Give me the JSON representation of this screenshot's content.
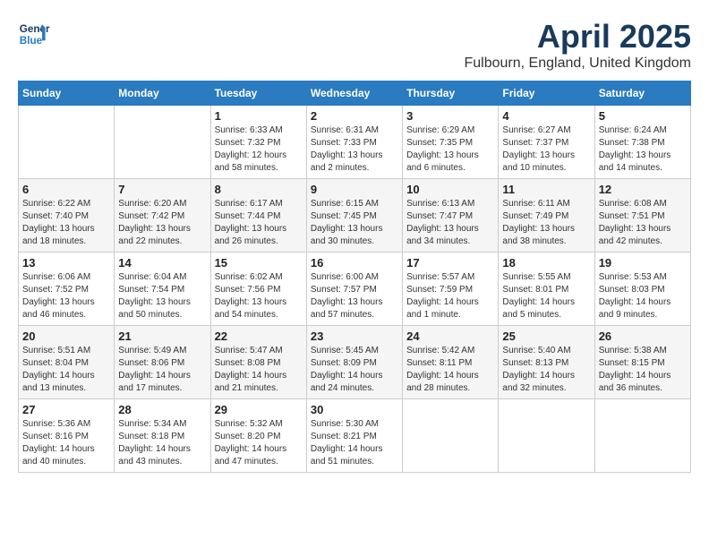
{
  "logo": {
    "line1": "General",
    "line2": "Blue"
  },
  "title": "April 2025",
  "location": "Fulbourn, England, United Kingdom",
  "days_of_week": [
    "Sunday",
    "Monday",
    "Tuesday",
    "Wednesday",
    "Thursday",
    "Friday",
    "Saturday"
  ],
  "weeks": [
    [
      {
        "day": "",
        "sunrise": "",
        "sunset": "",
        "daylight": ""
      },
      {
        "day": "",
        "sunrise": "",
        "sunset": "",
        "daylight": ""
      },
      {
        "day": "1",
        "sunrise": "Sunrise: 6:33 AM",
        "sunset": "Sunset: 7:32 PM",
        "daylight": "Daylight: 12 hours and 58 minutes."
      },
      {
        "day": "2",
        "sunrise": "Sunrise: 6:31 AM",
        "sunset": "Sunset: 7:33 PM",
        "daylight": "Daylight: 13 hours and 2 minutes."
      },
      {
        "day": "3",
        "sunrise": "Sunrise: 6:29 AM",
        "sunset": "Sunset: 7:35 PM",
        "daylight": "Daylight: 13 hours and 6 minutes."
      },
      {
        "day": "4",
        "sunrise": "Sunrise: 6:27 AM",
        "sunset": "Sunset: 7:37 PM",
        "daylight": "Daylight: 13 hours and 10 minutes."
      },
      {
        "day": "5",
        "sunrise": "Sunrise: 6:24 AM",
        "sunset": "Sunset: 7:38 PM",
        "daylight": "Daylight: 13 hours and 14 minutes."
      }
    ],
    [
      {
        "day": "6",
        "sunrise": "Sunrise: 6:22 AM",
        "sunset": "Sunset: 7:40 PM",
        "daylight": "Daylight: 13 hours and 18 minutes."
      },
      {
        "day": "7",
        "sunrise": "Sunrise: 6:20 AM",
        "sunset": "Sunset: 7:42 PM",
        "daylight": "Daylight: 13 hours and 22 minutes."
      },
      {
        "day": "8",
        "sunrise": "Sunrise: 6:17 AM",
        "sunset": "Sunset: 7:44 PM",
        "daylight": "Daylight: 13 hours and 26 minutes."
      },
      {
        "day": "9",
        "sunrise": "Sunrise: 6:15 AM",
        "sunset": "Sunset: 7:45 PM",
        "daylight": "Daylight: 13 hours and 30 minutes."
      },
      {
        "day": "10",
        "sunrise": "Sunrise: 6:13 AM",
        "sunset": "Sunset: 7:47 PM",
        "daylight": "Daylight: 13 hours and 34 minutes."
      },
      {
        "day": "11",
        "sunrise": "Sunrise: 6:11 AM",
        "sunset": "Sunset: 7:49 PM",
        "daylight": "Daylight: 13 hours and 38 minutes."
      },
      {
        "day": "12",
        "sunrise": "Sunrise: 6:08 AM",
        "sunset": "Sunset: 7:51 PM",
        "daylight": "Daylight: 13 hours and 42 minutes."
      }
    ],
    [
      {
        "day": "13",
        "sunrise": "Sunrise: 6:06 AM",
        "sunset": "Sunset: 7:52 PM",
        "daylight": "Daylight: 13 hours and 46 minutes."
      },
      {
        "day": "14",
        "sunrise": "Sunrise: 6:04 AM",
        "sunset": "Sunset: 7:54 PM",
        "daylight": "Daylight: 13 hours and 50 minutes."
      },
      {
        "day": "15",
        "sunrise": "Sunrise: 6:02 AM",
        "sunset": "Sunset: 7:56 PM",
        "daylight": "Daylight: 13 hours and 54 minutes."
      },
      {
        "day": "16",
        "sunrise": "Sunrise: 6:00 AM",
        "sunset": "Sunset: 7:57 PM",
        "daylight": "Daylight: 13 hours and 57 minutes."
      },
      {
        "day": "17",
        "sunrise": "Sunrise: 5:57 AM",
        "sunset": "Sunset: 7:59 PM",
        "daylight": "Daylight: 14 hours and 1 minute."
      },
      {
        "day": "18",
        "sunrise": "Sunrise: 5:55 AM",
        "sunset": "Sunset: 8:01 PM",
        "daylight": "Daylight: 14 hours and 5 minutes."
      },
      {
        "day": "19",
        "sunrise": "Sunrise: 5:53 AM",
        "sunset": "Sunset: 8:03 PM",
        "daylight": "Daylight: 14 hours and 9 minutes."
      }
    ],
    [
      {
        "day": "20",
        "sunrise": "Sunrise: 5:51 AM",
        "sunset": "Sunset: 8:04 PM",
        "daylight": "Daylight: 14 hours and 13 minutes."
      },
      {
        "day": "21",
        "sunrise": "Sunrise: 5:49 AM",
        "sunset": "Sunset: 8:06 PM",
        "daylight": "Daylight: 14 hours and 17 minutes."
      },
      {
        "day": "22",
        "sunrise": "Sunrise: 5:47 AM",
        "sunset": "Sunset: 8:08 PM",
        "daylight": "Daylight: 14 hours and 21 minutes."
      },
      {
        "day": "23",
        "sunrise": "Sunrise: 5:45 AM",
        "sunset": "Sunset: 8:09 PM",
        "daylight": "Daylight: 14 hours and 24 minutes."
      },
      {
        "day": "24",
        "sunrise": "Sunrise: 5:42 AM",
        "sunset": "Sunset: 8:11 PM",
        "daylight": "Daylight: 14 hours and 28 minutes."
      },
      {
        "day": "25",
        "sunrise": "Sunrise: 5:40 AM",
        "sunset": "Sunset: 8:13 PM",
        "daylight": "Daylight: 14 hours and 32 minutes."
      },
      {
        "day": "26",
        "sunrise": "Sunrise: 5:38 AM",
        "sunset": "Sunset: 8:15 PM",
        "daylight": "Daylight: 14 hours and 36 minutes."
      }
    ],
    [
      {
        "day": "27",
        "sunrise": "Sunrise: 5:36 AM",
        "sunset": "Sunset: 8:16 PM",
        "daylight": "Daylight: 14 hours and 40 minutes."
      },
      {
        "day": "28",
        "sunrise": "Sunrise: 5:34 AM",
        "sunset": "Sunset: 8:18 PM",
        "daylight": "Daylight: 14 hours and 43 minutes."
      },
      {
        "day": "29",
        "sunrise": "Sunrise: 5:32 AM",
        "sunset": "Sunset: 8:20 PM",
        "daylight": "Daylight: 14 hours and 47 minutes."
      },
      {
        "day": "30",
        "sunrise": "Sunrise: 5:30 AM",
        "sunset": "Sunset: 8:21 PM",
        "daylight": "Daylight: 14 hours and 51 minutes."
      },
      {
        "day": "",
        "sunrise": "",
        "sunset": "",
        "daylight": ""
      },
      {
        "day": "",
        "sunrise": "",
        "sunset": "",
        "daylight": ""
      },
      {
        "day": "",
        "sunrise": "",
        "sunset": "",
        "daylight": ""
      }
    ]
  ]
}
